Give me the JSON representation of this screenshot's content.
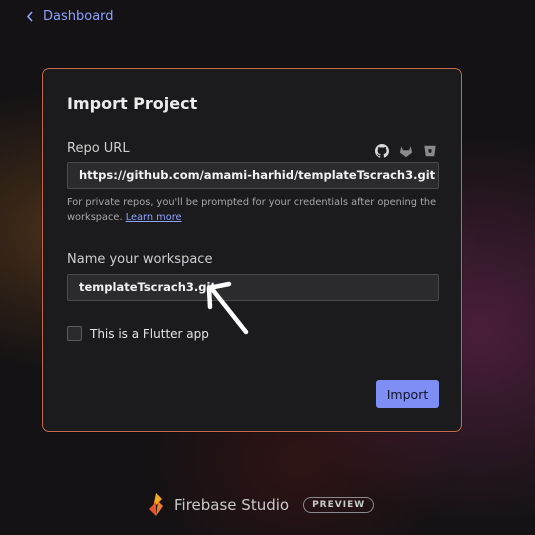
{
  "nav": {
    "back_label": "Dashboard"
  },
  "dialog": {
    "title": "Import Project",
    "repo": {
      "label": "Repo URL",
      "value": "https://github.com/amami-harhid/templateTscrach3.git",
      "helper": "For private repos, you'll be prompted for your credentials after opening the workspace.",
      "learn_more": "Learn more",
      "providers": [
        "github-icon",
        "gitlab-icon",
        "bitbucket-icon"
      ]
    },
    "workspace": {
      "label": "Name your workspace",
      "value": "templateTscrach3.git"
    },
    "flutter_checkbox": {
      "label": "This is a Flutter app",
      "checked": false
    },
    "import_button": "Import"
  },
  "footer": {
    "brand": "Firebase Studio",
    "badge": "PREVIEW"
  },
  "colors": {
    "accent": "#7f8ef5",
    "link": "#8ea2ff",
    "card_border": "#c56a4a"
  }
}
